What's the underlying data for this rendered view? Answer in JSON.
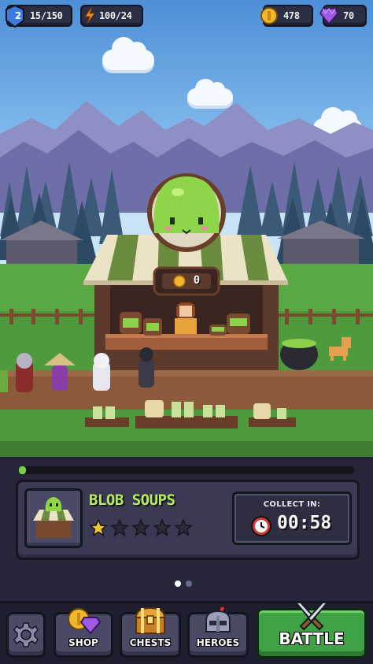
{
  "topbar": {
    "level": "2",
    "xp": "15/150",
    "energy": "100/24",
    "coins": "478",
    "gems": "70"
  },
  "stall": {
    "counter_value": "0"
  },
  "shop_info": {
    "name": "BLOB SOUPS",
    "stars_filled": 1,
    "stars_total": 5,
    "collect_label": "COLLECT IN:",
    "collect_time": "00:58",
    "progress": 0.02
  },
  "pager": {
    "active_index": 1,
    "count": 2
  },
  "nav": {
    "shop": "SHOP",
    "chests": "CHESTS",
    "heroes": "HEROES",
    "battle": "BATTLE"
  },
  "colors": {
    "accent_green": "#b5ea62",
    "battle_green": "#3fa244",
    "coin_gold": "#f3b62d",
    "gem_purple": "#a05ae6",
    "energy_orange": "#f08a1c",
    "xp_blue": "#3b7be0"
  },
  "icons": [
    "settings-gear-icon",
    "shop-coin-gem-icon",
    "chest-icon",
    "helmet-icon",
    "crossed-swords-icon",
    "clock-icon",
    "lightning-icon",
    "coin-icon",
    "gem-icon",
    "star-icon"
  ]
}
